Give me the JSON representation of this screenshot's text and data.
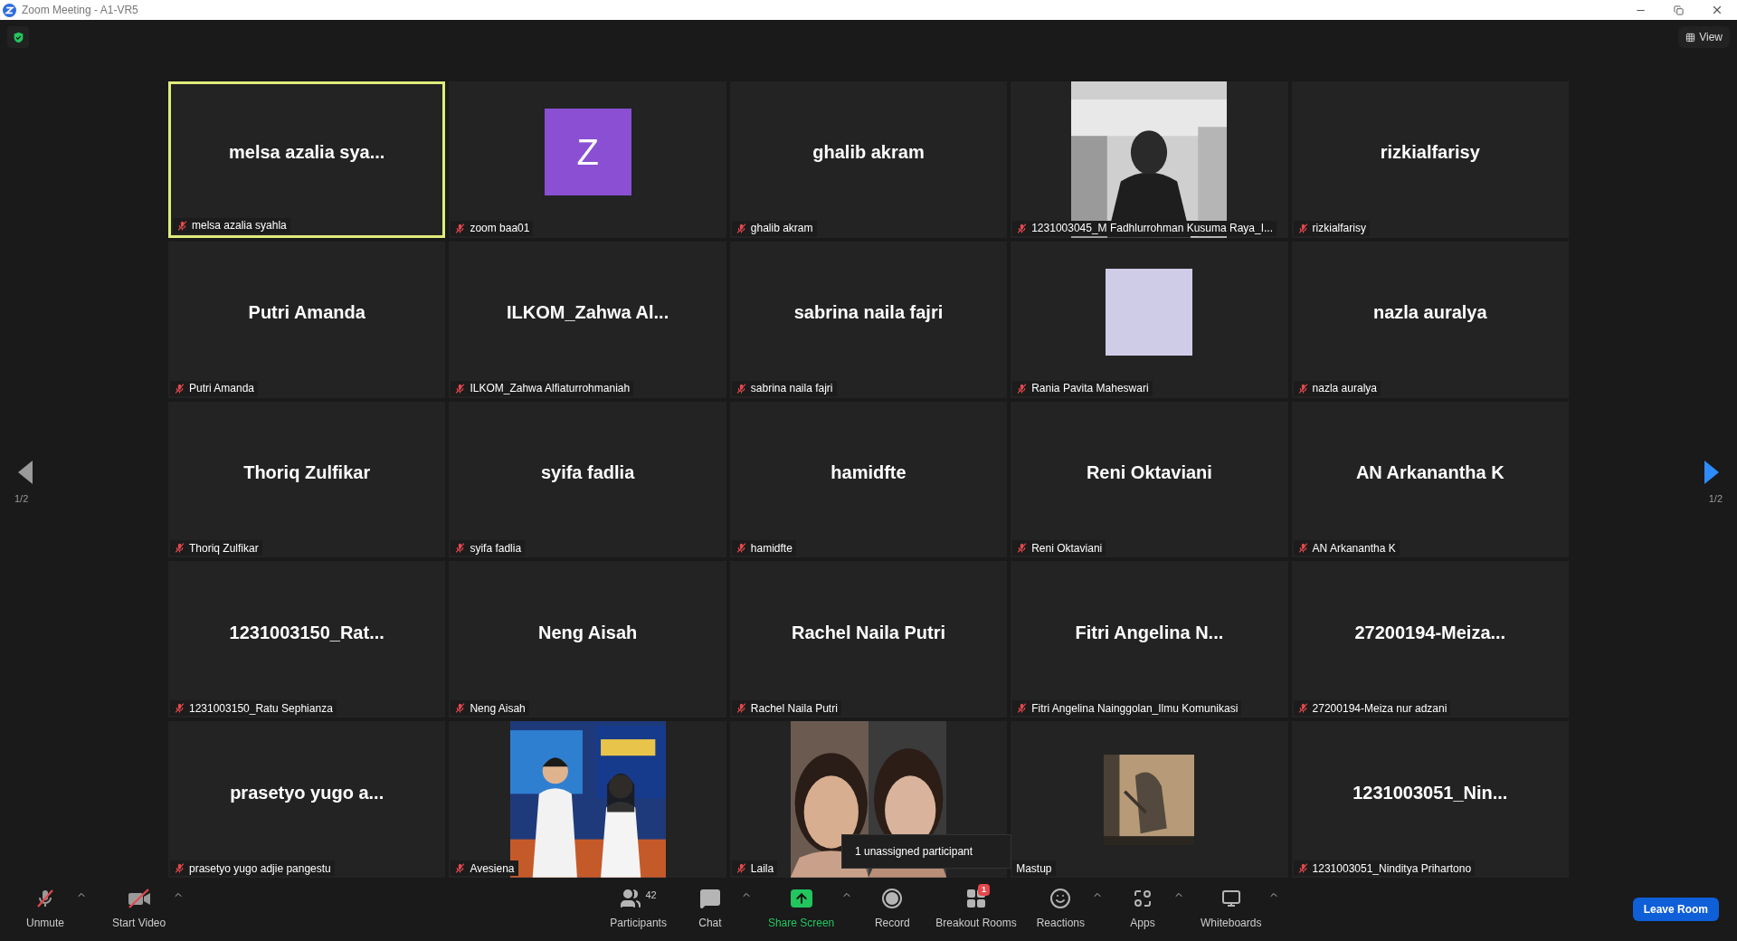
{
  "window": {
    "title": "Zoom Meeting - A1-VR5"
  },
  "view_button": {
    "label": "View"
  },
  "pager": {
    "previous": {
      "label": "1/2",
      "disabled": true
    },
    "next": {
      "label": "1/2",
      "disabled": false
    }
  },
  "tiles": [
    {
      "kind": "name",
      "display": "melsa azalia sya...",
      "label": "melsa azalia syahla",
      "speaking": true,
      "muted": true
    },
    {
      "kind": "letter",
      "display": "Z",
      "label": "zoom baa01",
      "speaking": false,
      "muted": true
    },
    {
      "kind": "name",
      "display": "ghalib akram",
      "label": "ghalib akram",
      "speaking": false,
      "muted": true
    },
    {
      "label": "1231003045_M Fadhlurrohman Kusuma Raya_I...",
      "speaking": false,
      "muted": true
    },
    {
      "kind": "name",
      "display": "rizkialfarisy",
      "label": "rizkialfarisy",
      "speaking": false,
      "muted": true
    },
    {
      "kind": "name",
      "display": "Putri Amanda",
      "label": "Putri Amanda",
      "speaking": false,
      "muted": true
    },
    {
      "kind": "name",
      "display": "ILKOM_Zahwa  Al...",
      "label": "ILKOM_Zahwa Alfiaturrohmaniah",
      "speaking": false,
      "muted": true
    },
    {
      "kind": "name",
      "display": "sabrina naila fajri",
      "label": "sabrina naila fajri",
      "speaking": false,
      "muted": true
    },
    {
      "kind": "plain",
      "label": "Rania Pavita Maheswari",
      "speaking": false,
      "muted": true
    },
    {
      "kind": "name",
      "display": "nazla auralya",
      "label": "nazla auralya",
      "speaking": false,
      "muted": true
    },
    {
      "kind": "name",
      "display": "Thoriq Zulfikar",
      "label": "Thoriq Zulfikar",
      "speaking": false,
      "muted": true
    },
    {
      "kind": "name",
      "display": "syifa fadlia",
      "label": "syifa fadlia",
      "speaking": false,
      "muted": true
    },
    {
      "kind": "name",
      "display": "hamidfte",
      "label": "hamidfte",
      "speaking": false,
      "muted": true
    },
    {
      "kind": "name",
      "display": "Reni Oktaviani",
      "label": "Reni Oktaviani",
      "speaking": false,
      "muted": true
    },
    {
      "kind": "name",
      "display": "AN Arkanantha K",
      "label": "AN Arkanantha K",
      "speaking": false,
      "muted": true
    },
    {
      "kind": "name",
      "display": "1231003150_Rat...",
      "label": "1231003150_Ratu Sephianza",
      "speaking": false,
      "muted": true
    },
    {
      "kind": "name",
      "display": "Neng Aisah",
      "label": "Neng Aisah",
      "speaking": false,
      "muted": true
    },
    {
      "kind": "name",
      "display": "Rachel Naila Putri",
      "label": "Rachel Naila Putri",
      "speaking": false,
      "muted": true
    },
    {
      "kind": "name",
      "display": "Fitri  Angelina  N...",
      "label": "Fitri Angelina Nainggolan_Ilmu Komunikasi",
      "speaking": false,
      "muted": true
    },
    {
      "kind": "name",
      "display": "27200194-Meiza...",
      "label": "27200194-Meiza nur adzani",
      "speaking": false,
      "muted": true
    },
    {
      "kind": "name",
      "display": "prasetyo yugo a...",
      "label": "prasetyo yugo adjie pangestu",
      "speaking": false,
      "muted": true
    },
    {
      "label": "Avesiena",
      "speaking": false,
      "muted": true
    },
    {
      "label": "Laila",
      "speaking": false,
      "muted": true
    },
    {
      "label": "Mastup",
      "speaking": false,
      "muted": false
    },
    {
      "kind": "name",
      "display": "1231003051_Nin...",
      "label": "1231003051_Ninditya Prihartono",
      "speaking": false,
      "muted": true
    }
  ],
  "tooltip": {
    "text": "1 unassigned participant"
  },
  "toolbar": {
    "items": [
      {
        "kind": "unmute",
        "label": "Unmute",
        "menu": true
      },
      {
        "kind": "video",
        "label": "Start Video",
        "menu": true
      },
      {
        "kind": "participants",
        "label": "Participants",
        "count": "42",
        "menu": false
      },
      {
        "kind": "chat",
        "label": "Chat",
        "menu": true
      },
      {
        "kind": "share",
        "label": "Share Screen",
        "menu": true
      },
      {
        "kind": "record",
        "label": "Record",
        "menu": false
      },
      {
        "kind": "breakout",
        "label": "Breakout Rooms",
        "badge": "1",
        "menu": false
      },
      {
        "kind": "reactions",
        "label": "Reactions",
        "menu": true
      },
      {
        "kind": "apps",
        "label": "Apps",
        "menu": true
      },
      {
        "kind": "whiteboards",
        "label": "Whiteboards",
        "menu": true
      }
    ],
    "leave": {
      "label": "Leave Room"
    }
  }
}
